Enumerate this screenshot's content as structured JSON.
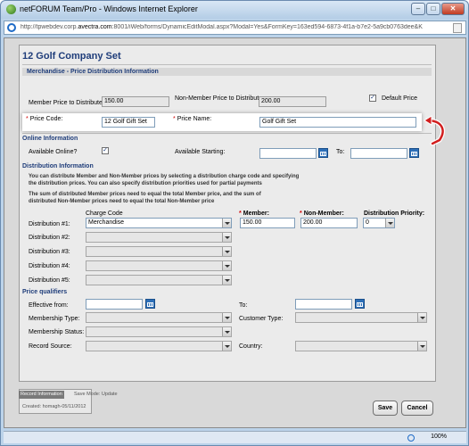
{
  "window": {
    "title": "netFORUM Team/Pro - Windows Internet Explorer"
  },
  "address": {
    "url_prefix": "http://tpwebdev.corp.",
    "url_domain": "avectra.com",
    "url_rest": ":8001/iWeb/forms/DynamicEditModal.aspx?Modal=Yes&FormKey=163ed594-6873-4f1a-b7e2-5a9cb0763dee&K"
  },
  "page": {
    "title": "12 Golf Company Set"
  },
  "price_section": {
    "header": "Merchandise - Price Distribution Information",
    "price_code_label": "Price Code:",
    "price_code": "12 Golf Gift Set",
    "price_name_label": "Price Name:",
    "price_name": "Golf Gift Set",
    "member_price_label": "Member Price to Distribute:",
    "member_price": "150.00",
    "non_member_price_label": "Non-Member Price to Distribute:",
    "non_member_price": "200.00",
    "default_price_label": "Default Price",
    "default_price_checked": true
  },
  "online": {
    "header": "Online Information",
    "available_label": "Available Online?",
    "available_checked": true,
    "starting_label": "Available Starting:",
    "to_label": "To:"
  },
  "distribution": {
    "header": "Distribution Information",
    "note1": "You can distribute Member and Non-Member prices by selecting a distribution charge code and specifying the distribution prices. You can also specify distribution priorities used for partial payments",
    "note2": "The sum of distributed Member prices need to equal the total Member price, and the sum of distributed Non-Member prices need to equal the total Non-Member price",
    "col_charge_code": "Charge Code",
    "col_member": "Member:",
    "col_non_member": "Non-Member:",
    "col_priority": "Distribution Priority:",
    "rows": [
      {
        "label": "Distribution #1:",
        "charge_code": "Merchandise",
        "member": "150.00",
        "non_member": "200.00",
        "priority": "0"
      },
      {
        "label": "Distribution #2:"
      },
      {
        "label": "Distribution #3:"
      },
      {
        "label": "Distribution #4:"
      },
      {
        "label": "Distribution #5:"
      }
    ]
  },
  "qualifiers": {
    "header": "Price qualifiers",
    "effective_from_label": "Effective from:",
    "to_label": "To:",
    "membership_type_label": "Membership Type:",
    "customer_type_label": "Customer Type:",
    "membership_status_label": "Membership Status:",
    "record_source_label": "Record Source:",
    "country_label": "Country:"
  },
  "footer": {
    "record_info": "Record Information",
    "save_mode": "Save Mode: Update",
    "created": "Created: homagh-05/11/2012",
    "save_label": "Save",
    "cancel_label": "Cancel"
  },
  "status": {
    "zoom": "100%"
  },
  "colors": {
    "title_blue": "#1f3d7a",
    "required_red": "#d00000",
    "arrow_red": "#d21f1f"
  },
  "icons": [
    "app-icon",
    "ie-icon",
    "page-icon",
    "calendar-icon",
    "curved-arrow-icon",
    "zoom-icon"
  ]
}
